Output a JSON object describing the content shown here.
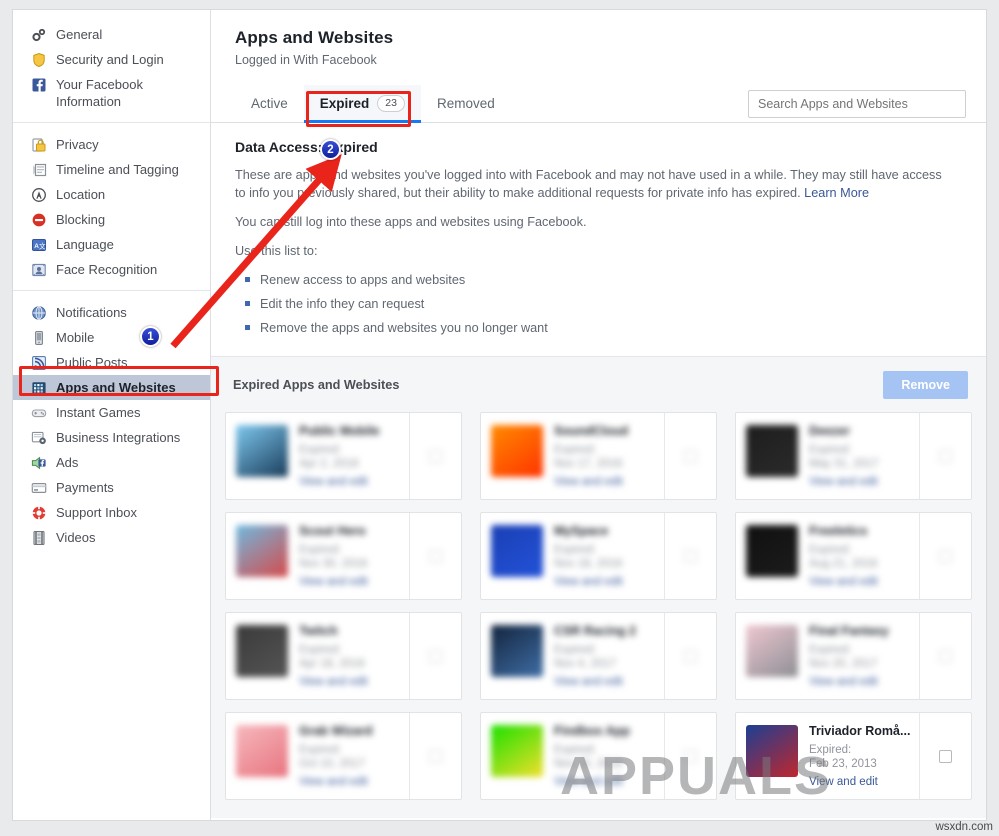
{
  "sidebar": {
    "groups": [
      {
        "items": [
          {
            "label": "General",
            "icon": "gears-icon",
            "name": "general",
            "selected": false
          },
          {
            "label": "Security and Login",
            "icon": "shield-icon",
            "name": "security-and-login",
            "selected": false
          },
          {
            "label": "Your Facebook Information",
            "icon": "facebook-icon",
            "name": "your-facebook-information",
            "selected": false
          }
        ]
      },
      {
        "items": [
          {
            "label": "Privacy",
            "icon": "lock-icon",
            "name": "privacy",
            "selected": false
          },
          {
            "label": "Timeline and Tagging",
            "icon": "timeline-icon",
            "name": "timeline-and-tagging",
            "selected": false
          },
          {
            "label": "Location",
            "icon": "location-icon",
            "name": "location",
            "selected": false
          },
          {
            "label": "Blocking",
            "icon": "block-icon",
            "name": "blocking",
            "selected": false
          },
          {
            "label": "Language",
            "icon": "language-icon",
            "name": "language",
            "selected": false
          },
          {
            "label": "Face Recognition",
            "icon": "face-icon",
            "name": "face-recognition",
            "selected": false
          }
        ]
      },
      {
        "items": [
          {
            "label": "Notifications",
            "icon": "globe-icon",
            "name": "notifications",
            "selected": false
          },
          {
            "label": "Mobile",
            "icon": "mobile-icon",
            "name": "mobile",
            "selected": false
          },
          {
            "label": "Public Posts",
            "icon": "rss-icon",
            "name": "public-posts",
            "selected": false
          },
          {
            "label": "Apps and Websites",
            "icon": "apps-icon",
            "name": "apps-and-websites",
            "selected": true
          },
          {
            "label": "Instant Games",
            "icon": "gamepad-icon",
            "name": "instant-games",
            "selected": false
          },
          {
            "label": "Business Integrations",
            "icon": "business-icon",
            "name": "business-integrations",
            "selected": false
          },
          {
            "label": "Ads",
            "icon": "ads-icon",
            "name": "ads",
            "selected": false
          },
          {
            "label": "Payments",
            "icon": "card-icon",
            "name": "payments",
            "selected": false
          },
          {
            "label": "Support Inbox",
            "icon": "lifebuoy-icon",
            "name": "support-inbox",
            "selected": false
          },
          {
            "label": "Videos",
            "icon": "film-icon",
            "name": "videos",
            "selected": false
          }
        ]
      }
    ]
  },
  "header": {
    "title": "Apps and Websites",
    "subtitle": "Logged in With Facebook"
  },
  "tabs": [
    {
      "label": "Active",
      "count": "",
      "active": false,
      "name": "tab-active"
    },
    {
      "label": "Expired",
      "count": "23",
      "active": true,
      "name": "tab-expired"
    },
    {
      "label": "Removed",
      "count": "",
      "active": false,
      "name": "tab-removed"
    }
  ],
  "search": {
    "placeholder": "Search Apps and Websites",
    "value": ""
  },
  "info": {
    "heading": "Data Access: Expired",
    "paragraph1": "These are apps and websites you've logged into with Facebook and may not have used in a while. They may still have access to info you previously shared, but their ability to make additional requests for private info has expired.",
    "learn_more": "Learn More",
    "paragraph2": "You can still log into these apps and websites using Facebook.",
    "list_intro": "Use this list to:",
    "bullets": [
      "Renew access to apps and websites",
      "Edit the info they can request",
      "Remove the apps and websites you no longer want"
    ]
  },
  "list": {
    "title": "Expired Apps and Websites",
    "remove_label": "Remove",
    "expired_prefix": "Expired:",
    "view_edit_label": "View and edit",
    "apps": [
      {
        "name": "Public Mobile",
        "expired": "Apr 2, 2018",
        "blurred": true,
        "icon_colors": [
          "#7ec8ef",
          "#1a3c5a"
        ]
      },
      {
        "name": "SoundCloud",
        "expired": "Nov 17, 2016",
        "blurred": true,
        "icon_colors": [
          "#ff8a00",
          "#ff3300"
        ]
      },
      {
        "name": "Deezer",
        "expired": "May 31, 2017",
        "blurred": true,
        "icon_colors": [
          "#1d1d1d",
          "#2b2b2b"
        ]
      },
      {
        "name": "Scout Hero",
        "expired": "Nov 30, 2016",
        "blurred": true,
        "icon_colors": [
          "#6fb9e0",
          "#d64a4a"
        ]
      },
      {
        "name": "MySpace",
        "expired": "Nov 18, 2016",
        "blurred": true,
        "icon_colors": [
          "#1a3fb5",
          "#2352d8"
        ]
      },
      {
        "name": "Freeletics",
        "expired": "Aug 21, 2016",
        "blurred": true,
        "icon_colors": [
          "#101010",
          "#1c1c1c"
        ]
      },
      {
        "name": "Twitch",
        "expired": "Apr 18, 2016",
        "blurred": true,
        "icon_colors": [
          "#3a3a3a",
          "#555555"
        ]
      },
      {
        "name": "CSR Racing 2",
        "expired": "Nov 4, 2017",
        "blurred": true,
        "icon_colors": [
          "#13243e",
          "#3f6ea5"
        ]
      },
      {
        "name": "Final Fantasy",
        "expired": "Nov 20, 2017",
        "blurred": true,
        "icon_colors": [
          "#efc7d1",
          "#8d8f94"
        ]
      },
      {
        "name": "Grab Wizard",
        "expired": "Oct 10, 2017",
        "blurred": true,
        "icon_colors": [
          "#f6b8bd",
          "#e8747f"
        ]
      },
      {
        "name": "Findbox App",
        "expired": "Nov 15, 2016",
        "blurred": true,
        "icon_colors": [
          "#1ae000",
          "#f2e02a"
        ]
      },
      {
        "name": "Triviador Romå...",
        "expired": "Feb 23, 2013",
        "blurred": false,
        "icon_colors": [
          "#1c3f94",
          "#c0272d"
        ]
      }
    ]
  },
  "annotations": {
    "badge1": "1",
    "badge2": "2"
  },
  "watermark": {
    "brand": "APPUALS",
    "credit": "wsxdn.com"
  },
  "colors": {
    "accent_blue": "#1877f2",
    "link_blue": "#385898",
    "annotation_red": "#e8241b",
    "badge_blue": "#1d31b5",
    "selected_nav": "#bdc7d8"
  }
}
